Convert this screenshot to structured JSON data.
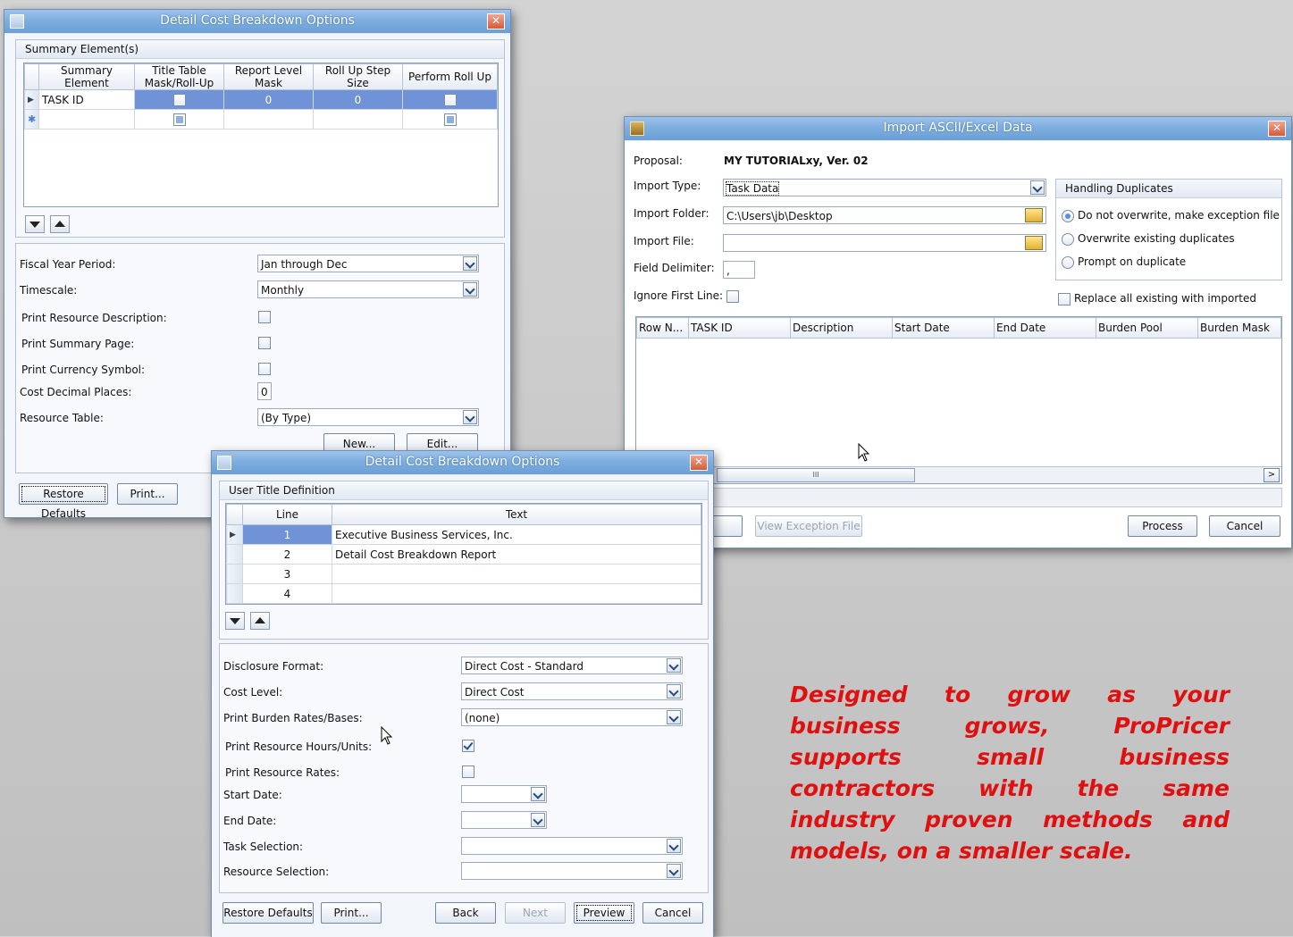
{
  "win1": {
    "title": "Detail Cost Breakdown Options",
    "summary_group_label": "Summary Element(s)",
    "columns": [
      "Summary Element",
      "Title Table Mask/Roll-Up",
      "Report Level Mask",
      "Roll Up Step Size",
      "Perform Roll Up"
    ],
    "rows": [
      {
        "element": "TASK ID",
        "report_level": "0",
        "step": "0"
      }
    ],
    "fields": {
      "fiscal_label": "Fiscal Year Period:",
      "fiscal_value": "Jan through Dec",
      "timescale_label": "Timescale:",
      "timescale_value": "Monthly",
      "print_res_desc_label": "Print Resource Description:",
      "print_summary_label": "Print Summary Page:",
      "print_currency_label": "Print Currency Symbol:",
      "decimal_label": "Cost Decimal Places:",
      "decimal_value": "0",
      "res_table_label": "Resource Table:",
      "res_table_value": "(By Type)"
    },
    "buttons": {
      "new": "New...",
      "edit": "Edit...",
      "restore": "Restore Defaults",
      "print": "Print..."
    }
  },
  "win2": {
    "title": "Import ASCII/Excel Data",
    "proposal_label": "Proposal:",
    "proposal_value": "MY TUTORIALxy, Ver. 02",
    "import_type_label": "Import Type:",
    "import_type_value": "Task Data",
    "import_folder_label": "Import Folder:",
    "import_folder_value": "C:\\Users\\jb\\Desktop",
    "import_file_label": "Import File:",
    "import_file_value": "",
    "delimiter_label": "Field Delimiter:",
    "delimiter_value": ",",
    "ignore_first_label": "Ignore First Line:",
    "dup_group_label": "Handling Duplicates",
    "dup_options": [
      "Do not overwrite, make exception file",
      "Overwrite existing duplicates",
      "Prompt on duplicate"
    ],
    "replace_label": "Replace all existing with imported",
    "columns": [
      "Row N...",
      "TASK ID",
      "Description",
      "Start Date",
      "End Date",
      "Burden Pool",
      "Burden Mask"
    ],
    "scroll_mark": "III",
    "buttons": {
      "view_exception": "View Exception File",
      "process": "Process",
      "cancel": "Cancel"
    }
  },
  "win3": {
    "title": "Detail Cost Breakdown Options",
    "group_label": "User Title Definition",
    "columns": [
      "Line",
      "Text"
    ],
    "rows": [
      {
        "line": "1",
        "text": "Executive Business Services, Inc."
      },
      {
        "line": "2",
        "text": "Detail Cost Breakdown Report"
      },
      {
        "line": "3",
        "text": ""
      },
      {
        "line": "4",
        "text": ""
      }
    ],
    "fields": {
      "disclosure_label": "Disclosure Format:",
      "disclosure_value": "Direct Cost - Standard",
      "cost_level_label": "Cost Level:",
      "cost_level_value": "Direct Cost",
      "burden_label": "Print Burden Rates/Bases:",
      "burden_value": "(none)",
      "res_hours_label": "Print Resource Hours/Units:",
      "res_rates_label": "Print Resource Rates:",
      "start_label": "Start Date:",
      "end_label": "End Date:",
      "task_sel_label": "Task Selection:",
      "res_sel_label": "Resource Selection:"
    },
    "buttons": {
      "restore": "Restore Defaults",
      "print": "Print...",
      "back": "Back",
      "next": "Next",
      "preview": "Preview",
      "cancel": "Cancel"
    }
  },
  "tagline": "Designed to grow as your business grows, ProPricer supports small business contractors with the same industry proven methods and models, on a smaller scale.",
  "colors": {
    "title_bar": "#7eaedf",
    "selection": "#6f93d6",
    "tagline": "#e01010"
  }
}
